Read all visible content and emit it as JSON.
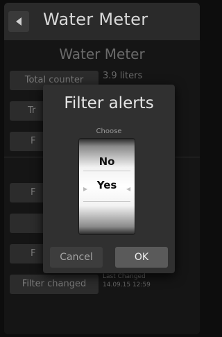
{
  "titlebar": {
    "title": "Water Meter"
  },
  "content": {
    "subtitle": "Water Meter",
    "total_counter_label": "Total counter",
    "total_counter_value": "3.9 liters",
    "btn2_partial": "Tr",
    "btn3_partial": "F",
    "btn4_partial": "F",
    "btn6_partial": "F",
    "filter_changed_label": "Filter changed",
    "last_changed_label": "Last Changed",
    "last_changed_value": "14.09.15 12:59"
  },
  "dialog": {
    "title": "Filter alerts",
    "choose_label": "Choose",
    "options": [
      "No",
      "Yes"
    ],
    "selected": "Yes",
    "cancel_label": "Cancel",
    "ok_label": "OK"
  },
  "colors": {
    "background": "#111111",
    "dialog": "#303030",
    "ok_button": "#5a5a5a"
  }
}
